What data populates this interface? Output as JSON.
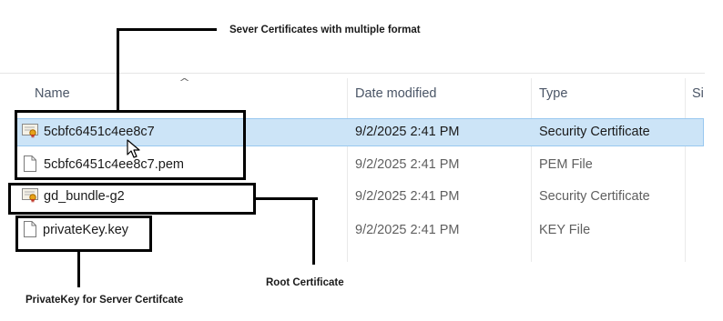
{
  "columns": {
    "name": "Name",
    "date": "Date modified",
    "type": "Type",
    "size": "Si"
  },
  "files": [
    {
      "name": "5cbfc6451c4ee8c7",
      "date": "9/2/2025 2:41 PM",
      "type": "Security Certificate",
      "icon": "certificate-icon",
      "selected": true
    },
    {
      "name": "5cbfc6451c4ee8c7.pem",
      "date": "9/2/2025 2:41 PM",
      "type": "PEM File",
      "icon": "document-icon",
      "selected": false
    },
    {
      "name": "gd_bundle-g2",
      "date": "9/2/2025 2:41 PM",
      "type": "Security Certificate",
      "icon": "certificate-icon",
      "selected": false
    },
    {
      "name": "privateKey.key",
      "date": "9/2/2025 2:41 PM",
      "type": "KEY File",
      "icon": "document-icon",
      "selected": false
    }
  ],
  "annotations": {
    "server_certs": "Sever Certificates with multiple format",
    "root_cert": "Root Certificate",
    "private_key": "PrivateKey for Server Certifcate"
  },
  "colors": {
    "selection": "#cce4f7",
    "selection_border": "#99c8ef",
    "callout": "#000000"
  }
}
